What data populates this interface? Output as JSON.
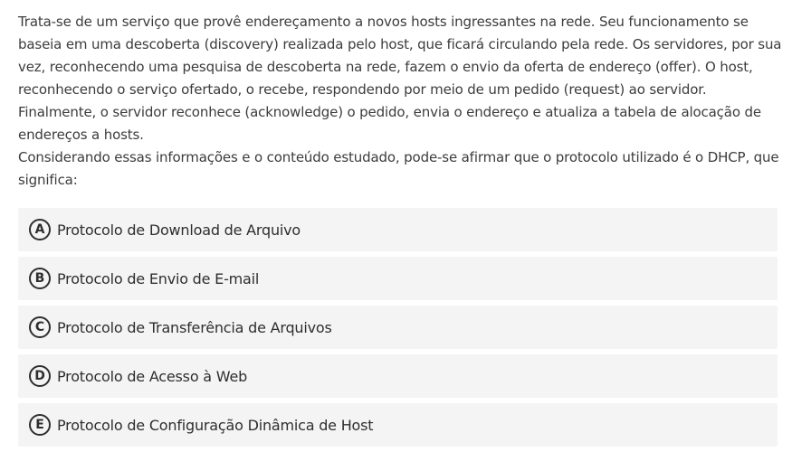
{
  "question": {
    "lines": [
      "Trata-se de um serviço que provê endereçamento a novos hosts ingressantes na rede. Seu funcionamento se",
      "baseia em uma descoberta (discovery) realizada pelo host, que ficará circulando pela rede. Os servidores, por sua",
      "vez, reconhecendo uma pesquisa de descoberta na rede, fazem o envio da oferta de endereço (offer). O host,",
      "reconhecendo o serviço ofertado, o recebe, respondendo por meio de um pedido (request) ao servidor.",
      "Finalmente, o servidor reconhece (acknowledge) o pedido, envia o endereço e atualiza a tabela de alocação de",
      "endereços a hosts.",
      "Considerando essas informações e o conteúdo estudado, pode-se afirmar que o protocolo utilizado é o DHCP, que",
      "significa:"
    ]
  },
  "options": [
    {
      "letter": "A",
      "text": "Protocolo de Download de Arquivo"
    },
    {
      "letter": "B",
      "text": "Protocolo de Envio de E-mail"
    },
    {
      "letter": "C",
      "text": "Protocolo de Transferência de Arquivos"
    },
    {
      "letter": "D",
      "text": "Protocolo de Acesso à Web"
    },
    {
      "letter": "E",
      "text": "Protocolo de Configuração Dinâmica de Host"
    }
  ],
  "colors": {
    "option_background": "#f4f4f4",
    "text": "#3c3c3c",
    "option_text": "#2e2e2e"
  }
}
